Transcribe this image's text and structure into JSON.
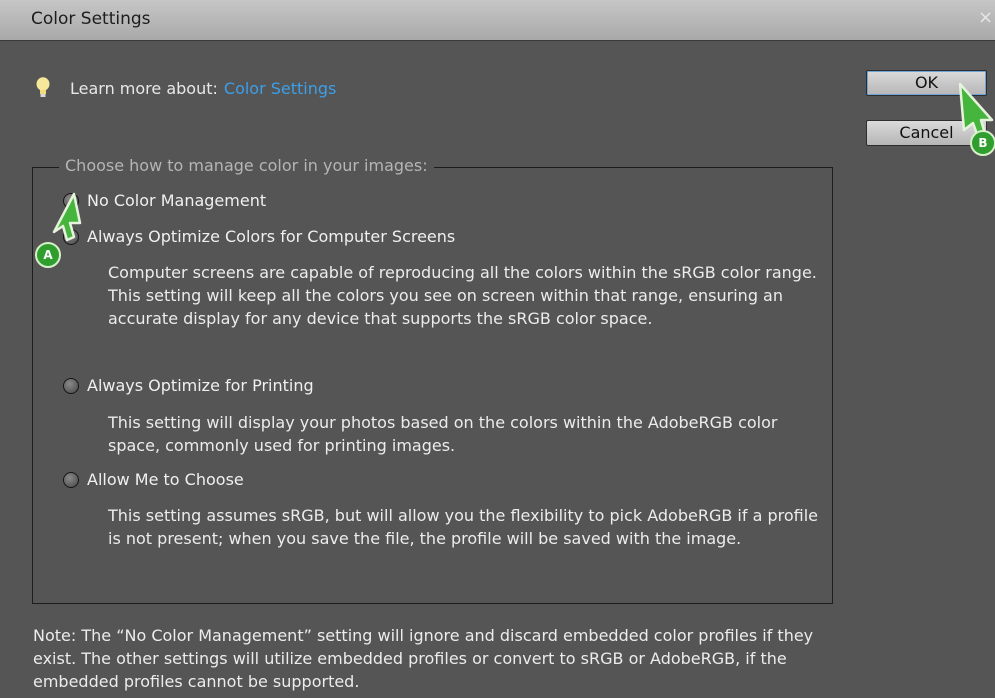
{
  "window": {
    "title": "Color Settings",
    "close_glyph": "×"
  },
  "learn": {
    "prefix": "Learn more about:",
    "link": "Color Settings",
    "icon": "lightbulb-icon"
  },
  "buttons": {
    "ok": "OK",
    "cancel": "Cancel"
  },
  "group": {
    "legend": "Choose how to manage color in your images:",
    "options": [
      {
        "label": "No Color Management",
        "description": ""
      },
      {
        "label": "Always Optimize Colors for Computer Screens",
        "description": "Computer screens are capable of reproducing all the colors within the sRGB color range. This setting will keep all the colors you see on screen within that range, ensuring an accurate display for any device that supports the sRGB color space."
      },
      {
        "label": "Always Optimize for Printing",
        "description": "This setting will display your photos based on the colors within the AdobeRGB color space, commonly used for printing images."
      },
      {
        "label": "Allow Me to Choose",
        "description": "This setting assumes sRGB, but will allow you the flexibility to pick AdobeRGB if a profile is not present; when you save the file, the profile will be saved with the image."
      }
    ]
  },
  "note": "Note: The “No Color Management” setting will ignore and discard embedded color profiles if they exist. The other settings will utilize embedded profiles or convert to sRGB or AdobeRGB, if the embedded profiles cannot be supported.",
  "annotations": {
    "marker_a": "A",
    "marker_b": "B"
  },
  "colors": {
    "link": "#3c9fe8",
    "dialog_bg": "#555555",
    "cursor_green": "#2f9e2f"
  }
}
